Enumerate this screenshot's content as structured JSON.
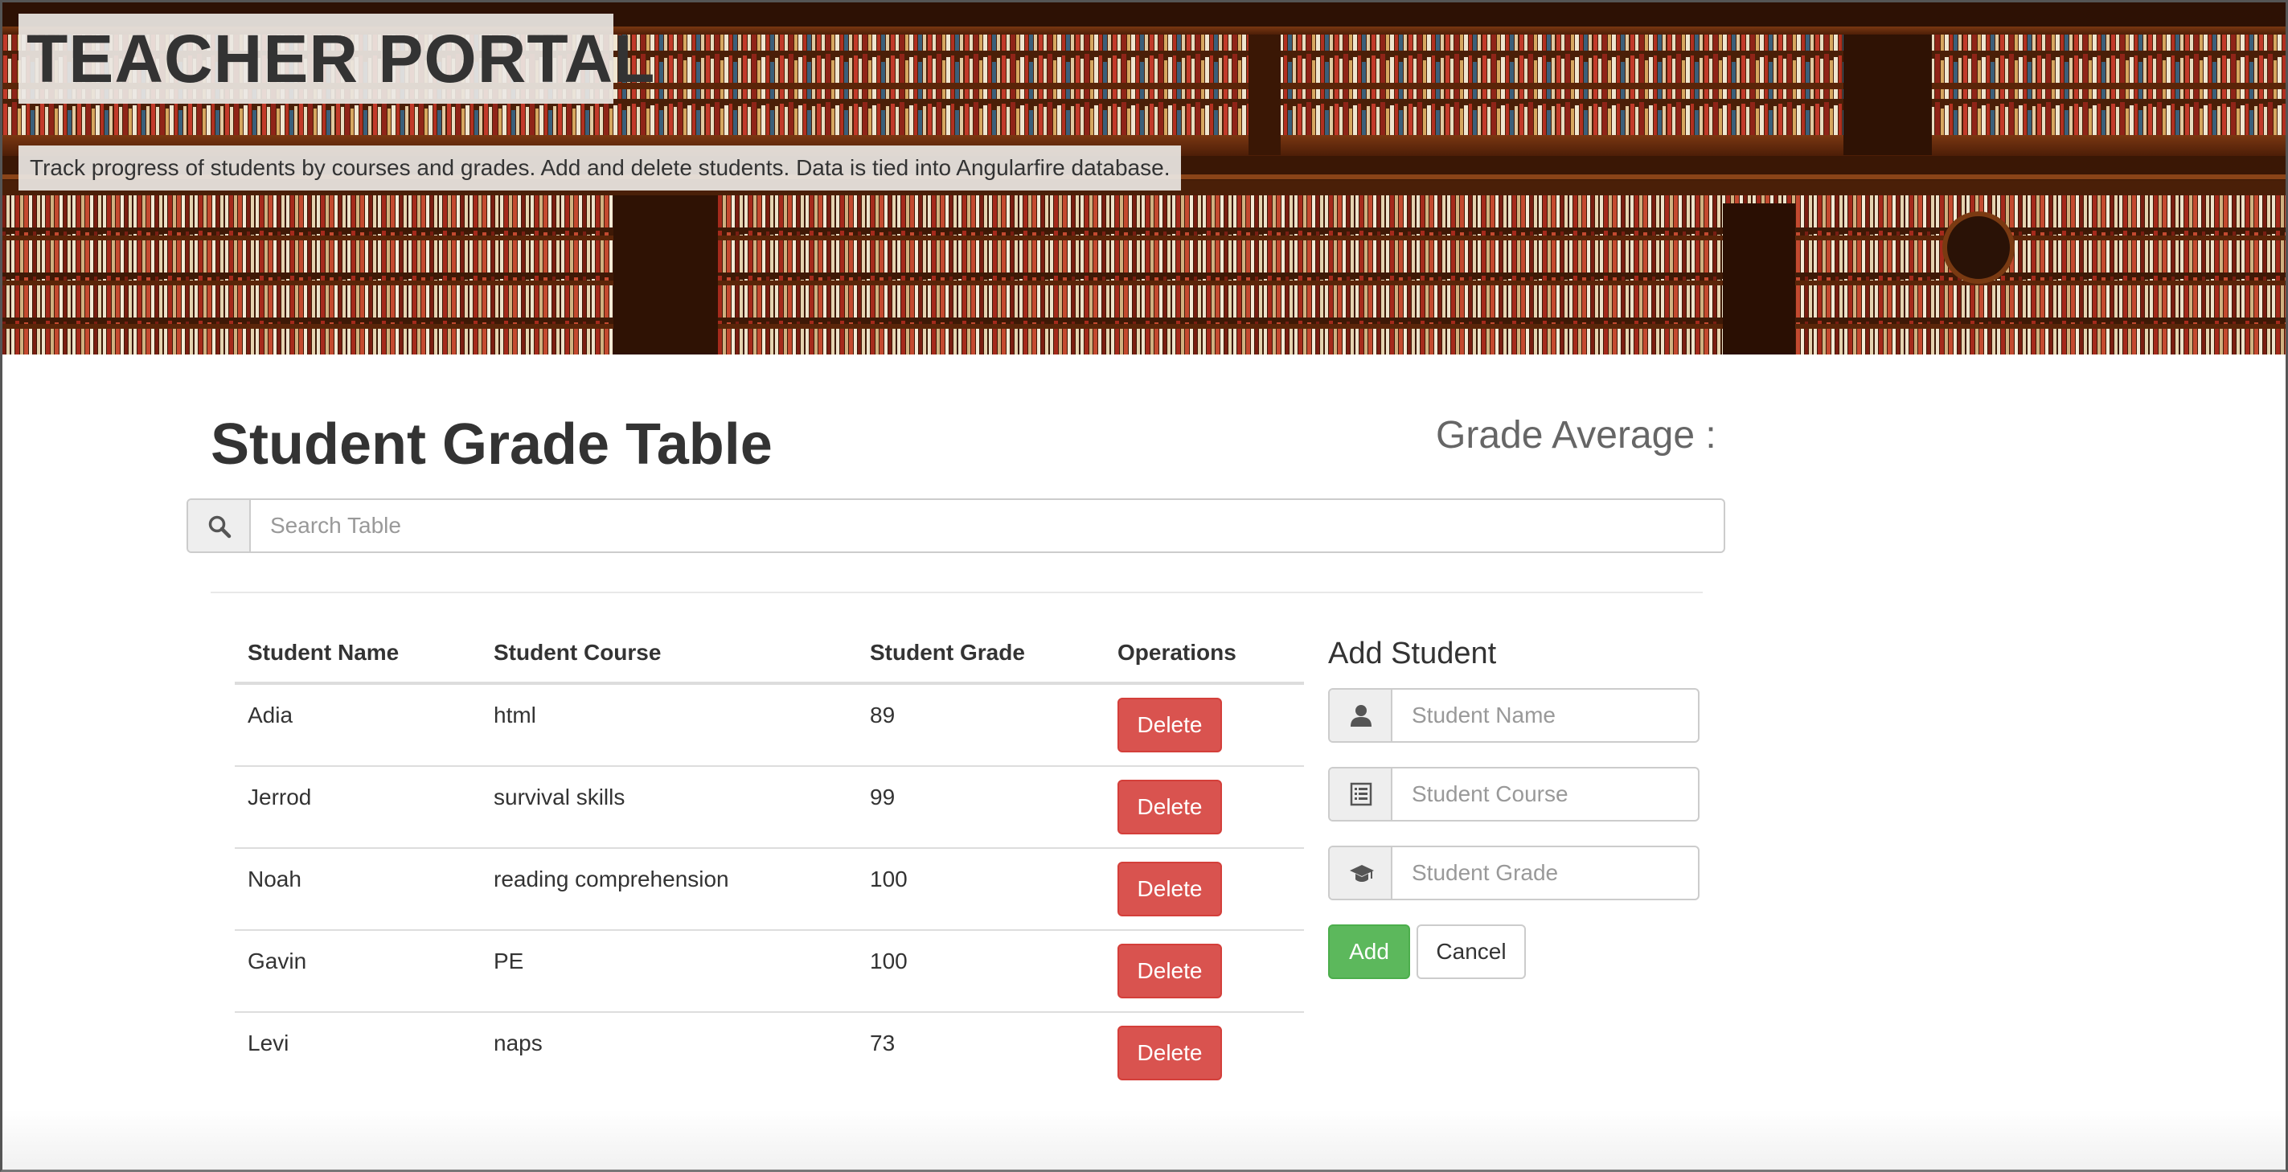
{
  "header": {
    "title": "TEACHER PORTAL",
    "description": "Track progress of students by courses and grades. Add and delete students. Data is tied into Angularfire database."
  },
  "main": {
    "title": "Student Grade Table",
    "grade_average_label": "Grade Average :",
    "search": {
      "placeholder": "Search Table",
      "value": "",
      "icon": "search-icon"
    }
  },
  "table": {
    "columns": [
      "Student Name",
      "Student Course",
      "Student Grade",
      "Operations"
    ],
    "rows": [
      {
        "name": "Adia",
        "course": "html",
        "grade": "89",
        "action": "Delete"
      },
      {
        "name": "Jerrod",
        "course": "survival skills",
        "grade": "99",
        "action": "Delete"
      },
      {
        "name": "Noah",
        "course": "reading comprehension",
        "grade": "100",
        "action": "Delete"
      },
      {
        "name": "Gavin",
        "course": "PE",
        "grade": "100",
        "action": "Delete"
      },
      {
        "name": "Levi",
        "course": "naps",
        "grade": "73",
        "action": "Delete"
      }
    ]
  },
  "form": {
    "title": "Add Student",
    "fields": [
      {
        "placeholder": "Student Name",
        "value": "",
        "icon": "user-icon"
      },
      {
        "placeholder": "Student Course",
        "value": "",
        "icon": "list-icon"
      },
      {
        "placeholder": "Student Grade",
        "value": "",
        "icon": "graduation-cap-icon"
      }
    ],
    "add_label": "Add",
    "cancel_label": "Cancel"
  },
  "colors": {
    "delete": "#d9534f",
    "add": "#5cb85c",
    "banner_wood": "#6b2e0f"
  }
}
